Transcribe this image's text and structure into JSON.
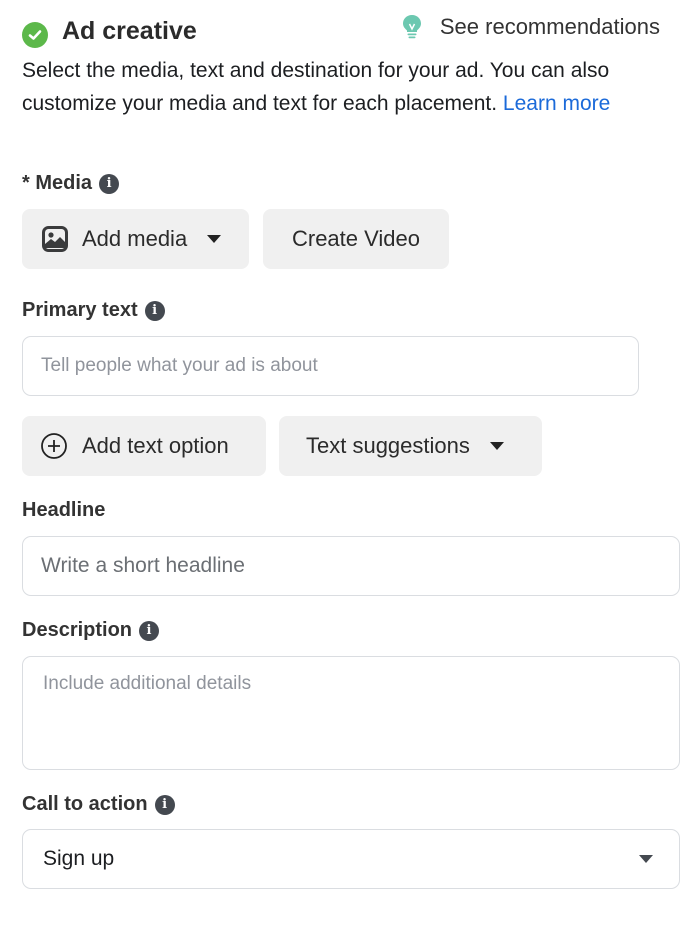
{
  "header": {
    "title": "Ad creative",
    "status_icon": "check-circle-icon",
    "status_color": "#5cb84a",
    "recommendations_label": "See recommendations",
    "recommendations_icon": "lightbulb-icon",
    "recommendations_icon_color": "#6cc8b0"
  },
  "intro": {
    "text": "Select the media, text and destination for your ad. You can also customize your media and text for each placement.",
    "link_label": "Learn more",
    "link_color": "#1b6ad9"
  },
  "media": {
    "required_marker": "*",
    "label": "Media",
    "add_media_label": "Add media",
    "create_video_label": "Create Video"
  },
  "primary_text": {
    "label": "Primary text",
    "placeholder": "Tell people what your ad is about",
    "add_text_option_label": "Add text option",
    "text_suggestions_label": "Text suggestions"
  },
  "headline": {
    "label": "Headline",
    "placeholder": "Write a short headline"
  },
  "description": {
    "label": "Description",
    "placeholder": "Include additional details"
  },
  "call_to_action": {
    "label": "Call to action",
    "selected": "Sign up"
  }
}
